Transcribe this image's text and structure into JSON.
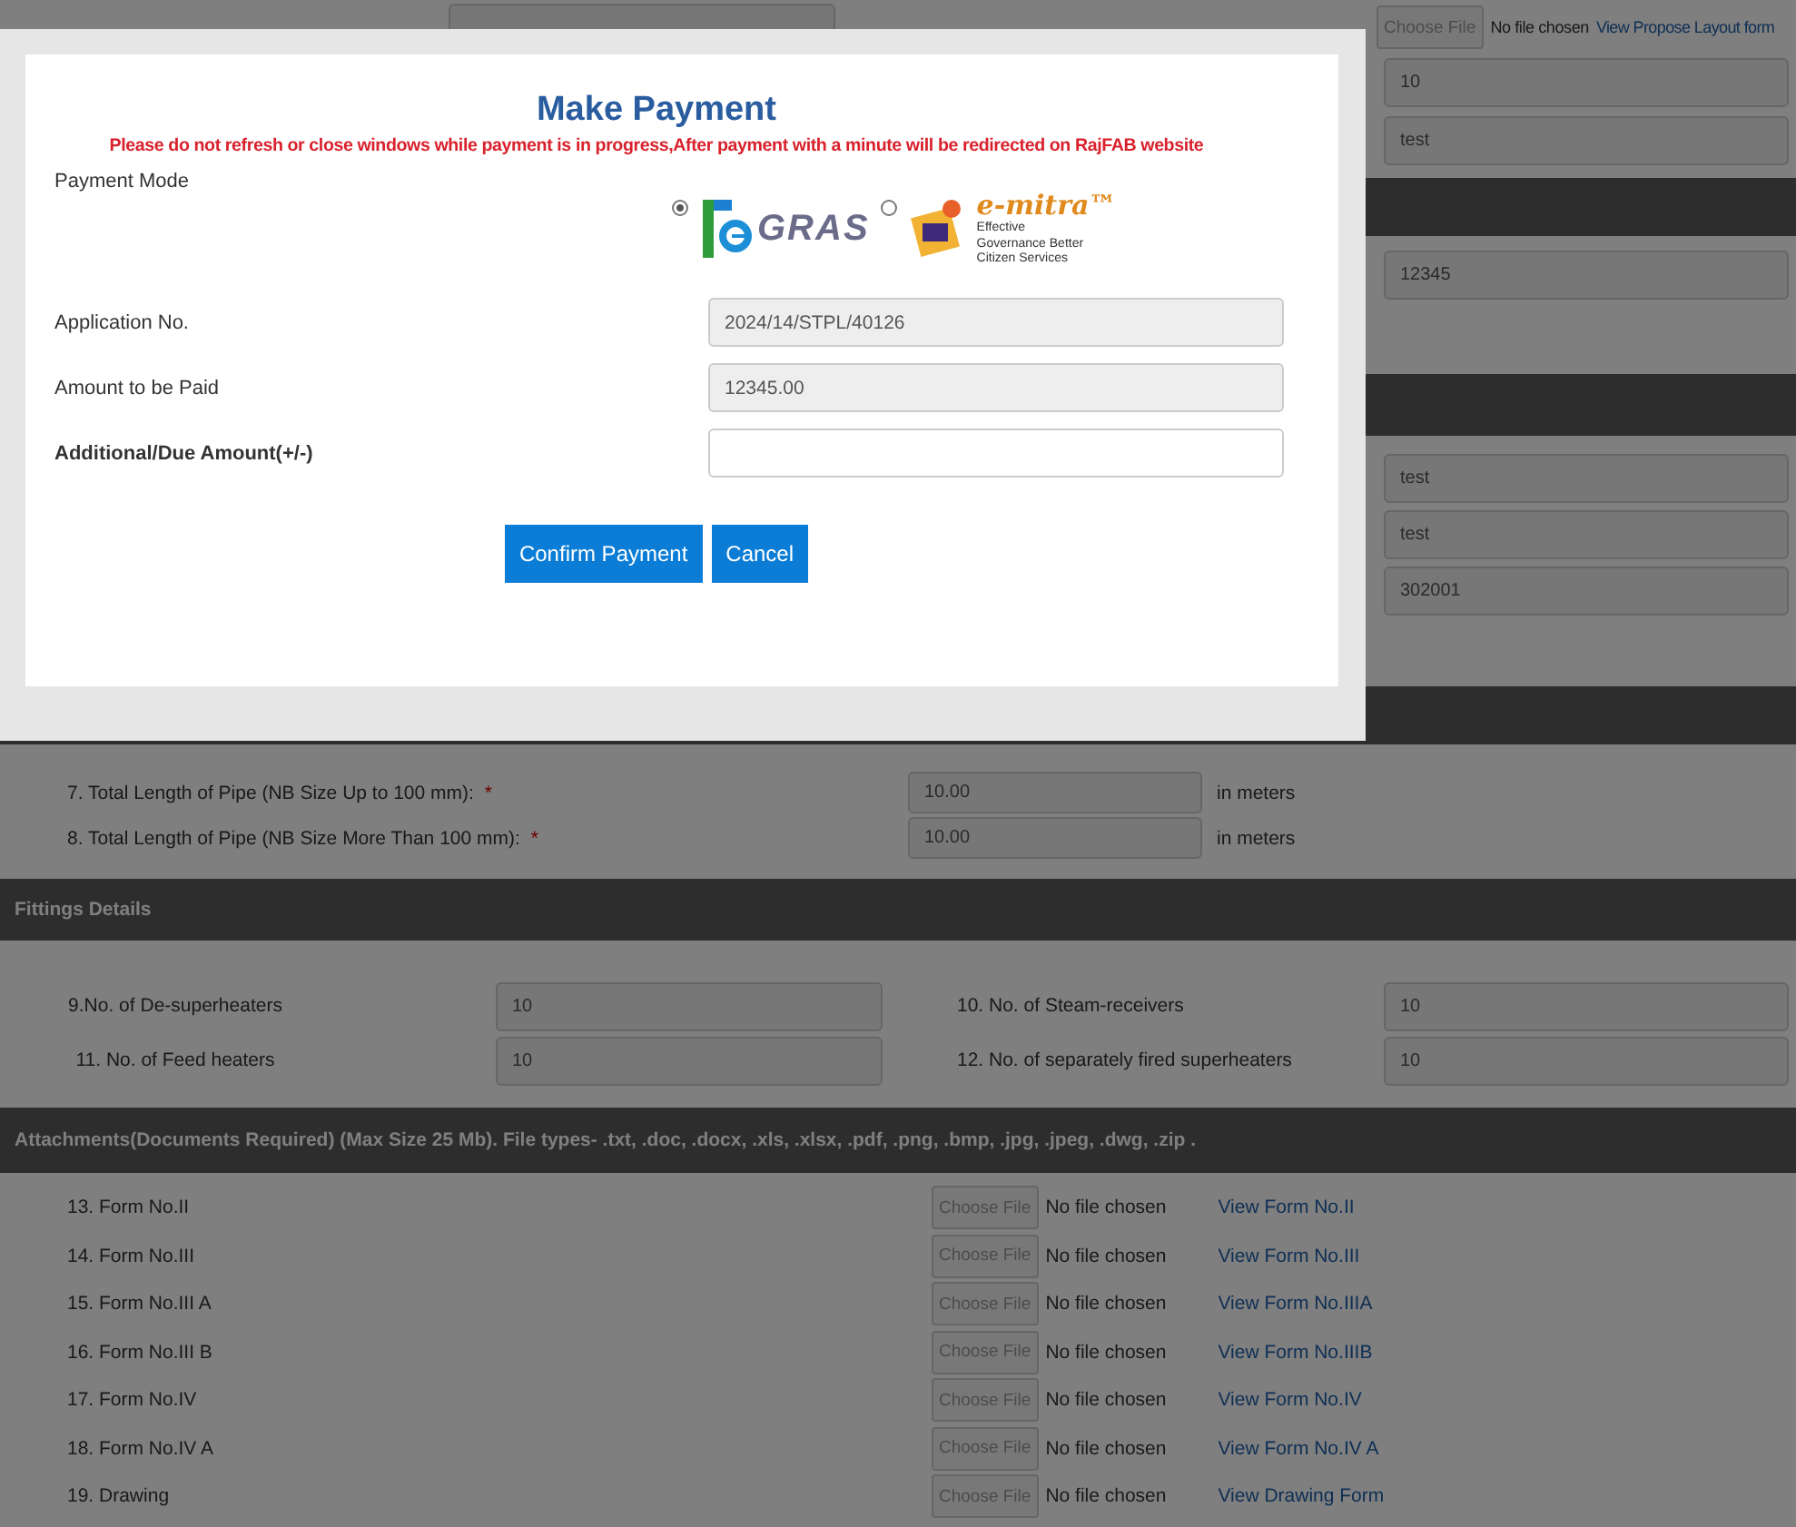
{
  "form": {
    "top_row": {
      "file_button": "Choose File",
      "file_status": "No file chosen",
      "link": "View Propose Layout form"
    },
    "right_fields_a": [
      "10",
      "test"
    ],
    "right_fields_b": [
      "12345"
    ],
    "right_fields_c": [
      "test",
      "test",
      "302001"
    ],
    "pipe_rows": [
      {
        "label": "7. Total Length of Pipe (NB Size Up to 100 mm):",
        "required": "*",
        "value": "10.00",
        "unit": "in meters"
      },
      {
        "label": "8. Total Length of Pipe (NB Size More Than 100 mm):",
        "required": "*",
        "value": "10.00",
        "unit": "in meters"
      }
    ],
    "fittings": {
      "title": "Fittings Details",
      "rows": [
        [
          {
            "label": "9.No. of De-superheaters",
            "value": "10"
          },
          {
            "label": "10. No. of Steam-receivers",
            "value": "10"
          }
        ],
        [
          {
            "label": "11. No. of Feed heaters",
            "value": "10"
          },
          {
            "label": "12. No. of separately fired superheaters",
            "value": "10"
          }
        ]
      ]
    },
    "attachments": {
      "title": "Attachments(Documents Required) (Max Size 25 Mb). File types- .txt, .doc, .docx, .xls, .xlsx, .pdf, .png, .bmp, .jpg, .jpeg, .dwg, .zip .",
      "rows": [
        {
          "label": "13. Form No.II",
          "button": "Choose File",
          "status": "No file chosen",
          "link": "View Form No.II"
        },
        {
          "label": "14. Form No.III",
          "button": "Choose File",
          "status": "No file chosen",
          "link": "View Form No.III"
        },
        {
          "label": "15. Form No.III A",
          "button": "Choose File",
          "status": "No file chosen",
          "link": "View Form No.IIIA"
        },
        {
          "label": "16. Form No.III B",
          "button": "Choose File",
          "status": "No file chosen",
          "link": "View Form No.IIIB"
        },
        {
          "label": "17. Form No.IV",
          "button": "Choose File",
          "status": "No file chosen",
          "link": "View Form No.IV"
        },
        {
          "label": "18. Form No.IV A",
          "button": "Choose File",
          "status": "No file chosen",
          "link": "View Form No.IV A"
        },
        {
          "label": "19. Drawing",
          "button": "Choose File",
          "status": "No file chosen",
          "link": "View Drawing Form"
        }
      ]
    }
  },
  "modal": {
    "title": "Make Payment",
    "warning": "Please do not refresh or close windows while payment is in progress,After payment with a minute will be redirected on RajFAB website",
    "payment_mode_label": "Payment Mode",
    "payment_modes": [
      {
        "kind": "egras",
        "name": "GRAS",
        "selected": true
      },
      {
        "kind": "emitra",
        "name": "e-mitra™",
        "tagline": "Effective Governance Better Citizen Services",
        "selected": false
      }
    ],
    "fields": [
      {
        "label": "Application No.",
        "value": "2024/14/STPL/40126",
        "readonly": true,
        "bold": false
      },
      {
        "label": "Amount to be Paid",
        "value": "12345.00",
        "readonly": true,
        "bold": false
      },
      {
        "label": "Additional/Due Amount(+/-)",
        "readonly": false,
        "bold": true
      }
    ],
    "buttons": [
      "Confirm Payment",
      "Cancel"
    ]
  }
}
